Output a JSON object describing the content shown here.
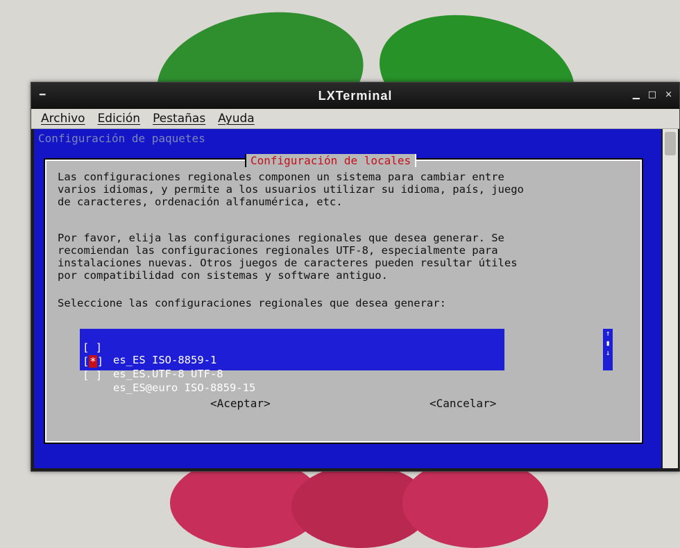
{
  "window": {
    "title": "LXTerminal",
    "menu_icon": "━",
    "controls": {
      "minimize": "▁",
      "maximize": "□",
      "close": "×"
    }
  },
  "menubar": {
    "items": [
      "Archivo",
      "Edición",
      "Pestañas",
      "Ayuda"
    ]
  },
  "terminal": {
    "header": "Configuración de paquetes",
    "dialog": {
      "title": "Configuración de locales",
      "paragraph1": "Las configuraciones regionales componen un sistema para cambiar entre\nvarios idiomas, y permite a los usuarios utilizar su idioma, país, juego\nde caracteres, ordenación alfanumérica, etc.",
      "paragraph2": "Por favor, elija las configuraciones regionales que desea generar. Se\nrecomiendan las configuraciones regionales UTF-8, especialmente para\ninstalaciones nuevas. Otros juegos de caracteres pueden resultar útiles\npor compatibilidad con sistemas y software antiguo.",
      "prompt": "Seleccione las configuraciones regionales que desea generar:",
      "options": [
        {
          "check_open": "[",
          "check_mark": " ",
          "check_close": "]",
          "label": "es_ES ISO-8859-1"
        },
        {
          "check_open": "[",
          "check_mark": "*",
          "check_close": "]",
          "label": "es_ES.UTF-8 UTF-8"
        },
        {
          "check_open": "[",
          "check_mark": " ",
          "check_close": "]",
          "label": "es_ES@euro ISO-8859-15"
        }
      ],
      "list_scroll": {
        "up": "↑",
        "thumb": "▮",
        "down": "↓"
      },
      "ok_button": "<Aceptar>",
      "cancel_button": "<Cancelar>"
    }
  }
}
